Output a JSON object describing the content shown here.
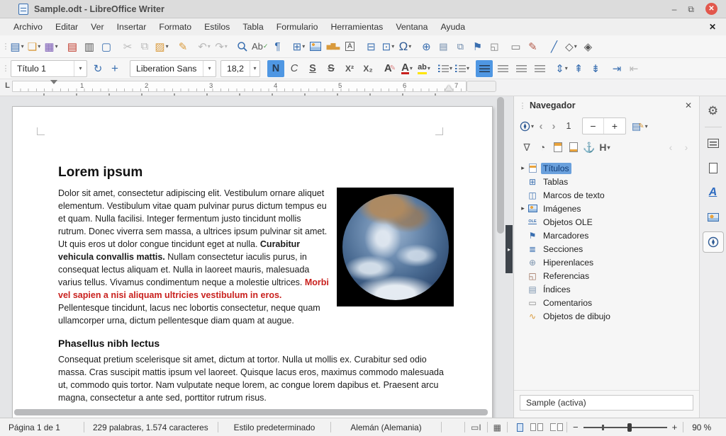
{
  "titlebar": {
    "title": "Sample.odt - LibreOffice Writer"
  },
  "menubar": {
    "items": [
      "Archivo",
      "Editar",
      "Ver",
      "Insertar",
      "Formato",
      "Estilos",
      "Tabla",
      "Formulario",
      "Herramientas",
      "Ventana",
      "Ayuda"
    ]
  },
  "icons": {
    "grip": "⋮",
    "dropdown": "▾",
    "tree_arrow": "▸",
    "minimize": "–",
    "restore": "⧉",
    "close": "✕",
    "menu_close": "✕",
    "new_doc": "▤",
    "open": "❏",
    "save": "▦",
    "export_pdf": "▤",
    "print": "▥",
    "preview": "▢",
    "cut": "✂",
    "copy": "⧉",
    "paste": "▨",
    "clone": "✎",
    "undo": "↶",
    "redo": "↷",
    "spelling": "Ab",
    "spelling_check": "✓",
    "para_mark": "¶",
    "table": "⊞",
    "chart": "▅▇▃",
    "textbox": "A",
    "page_break": "⊟",
    "field": "⊡",
    "omega": "Ω",
    "hyperlink": "⊕",
    "footnote": "▤",
    "endnote": "⧉",
    "bookmark": "⚑",
    "crossref": "◱",
    "comment": "▭",
    "track": "✎",
    "line": "╱",
    "shape": "◇",
    "draw": "◈",
    "update_style": "↻",
    "add_style": "+",
    "bold": "N",
    "italic": "C",
    "underline": "S",
    "strike": "S",
    "sup": "X²",
    "sub": "X₂",
    "clear_fmt": "A",
    "font_color": "A",
    "highlight": "ab",
    "line_space": "⇕",
    "para_inc": "⇞",
    "para_dec": "⇟",
    "indent_inc": "⇥",
    "indent_dec": "⇤",
    "nav_prev": "‹",
    "nav_next": "›",
    "minus": "−",
    "plus": "+",
    "drag_edit": "▤",
    "filter": "∇",
    "reminder": "◔",
    "anchor": "⚓",
    "heading": "H",
    "chev_up": "‹",
    "chev_dn": "›",
    "ole": "OLE",
    "sections": "≣",
    "frame": "◫",
    "flag": "⚑",
    "globe": "⊕",
    "refs": "◱",
    "index": "▤",
    "comment_t": "▭",
    "curve": "∿",
    "tab_l": "L",
    "sel_mode": "▭I",
    "save_state": "▦",
    "gear": "⚙",
    "styles_a": "A"
  },
  "formatting": {
    "paragraph_style": "Título 1",
    "font_name": "Liberation Sans",
    "font_size": "18,2"
  },
  "ruler": {
    "marks": [
      "1",
      "2",
      "3",
      "4",
      "5",
      "6",
      "7"
    ]
  },
  "document": {
    "heading1": "Lorem ipsum",
    "p1_normal1": "Dolor sit amet, consectetur adipiscing elit. Vestibulum ornare aliquet elementum. Vestibulum vitae quam pulvinar purus dictum tempus eu et quam. Nulla facilisi. Integer fermentum justo tincidunt mollis rutrum. Donec viverra sem massa, a ultrices ipsum pulvinar sit amet. Ut quis eros ut dolor congue tincidunt eget at nulla. ",
    "p1_bold": "Curabitur vehicula convallis mattis.",
    "p1_normal2": " Nullam consectetur iaculis purus, in consequat lectus aliquam et. Nulla in laoreet mauris, malesuada varius tellus. Vivamus condimentum neque a molestie ultrices. ",
    "p1_red": "Morbi vel sapien a nisi aliquam ultricies vestibulum in eros.",
    "p1_normal3": " Pellentesque tincidunt, lacus nec lobortis consectetur, neque quam ullamcorper urna, dictum pellentesque diam quam at augue.",
    "heading2": "Phasellus nibh lectus",
    "p2": "Consequat pretium scelerisque sit amet, dictum at tortor. Nulla ut mollis ex. Curabitur sed odio massa. Cras suscipit mattis ipsum vel laoreet. Quisque lacus eros, maximus commodo malesuada ut, commodo quis tortor. Nam vulputate neque lorem, ac congue lorem dapibus et. Praesent arcu magna, consectetur a ante sed, porttitor rutrum risus."
  },
  "navigator": {
    "title": "Navegador",
    "page_number": "1",
    "items": [
      "Títulos",
      "Tablas",
      "Marcos de texto",
      "Imágenes",
      "Objetos OLE",
      "Marcadores",
      "Secciones",
      "Hiperenlaces",
      "Referencias",
      "Índices",
      "Comentarios",
      "Objetos de dibujo"
    ],
    "active_doc": "Sample (activa)"
  },
  "statusbar": {
    "page_info": "Página 1 de 1",
    "word_count": "229 palabras, 1.574 caracteres",
    "page_style": "Estilo predeterminado",
    "language": "Alemán (Alemania)",
    "zoom_level": "90 %"
  },
  "colors": {
    "accent_blue": "#4f97e3",
    "icon_blue": "#3a6fb0",
    "icon_amber": "#d99a3c",
    "close_red": "#e2574c",
    "text_red": "#c9211e",
    "selection_blue": "#6aa0dc",
    "save_purple": "#7b5bb5"
  }
}
